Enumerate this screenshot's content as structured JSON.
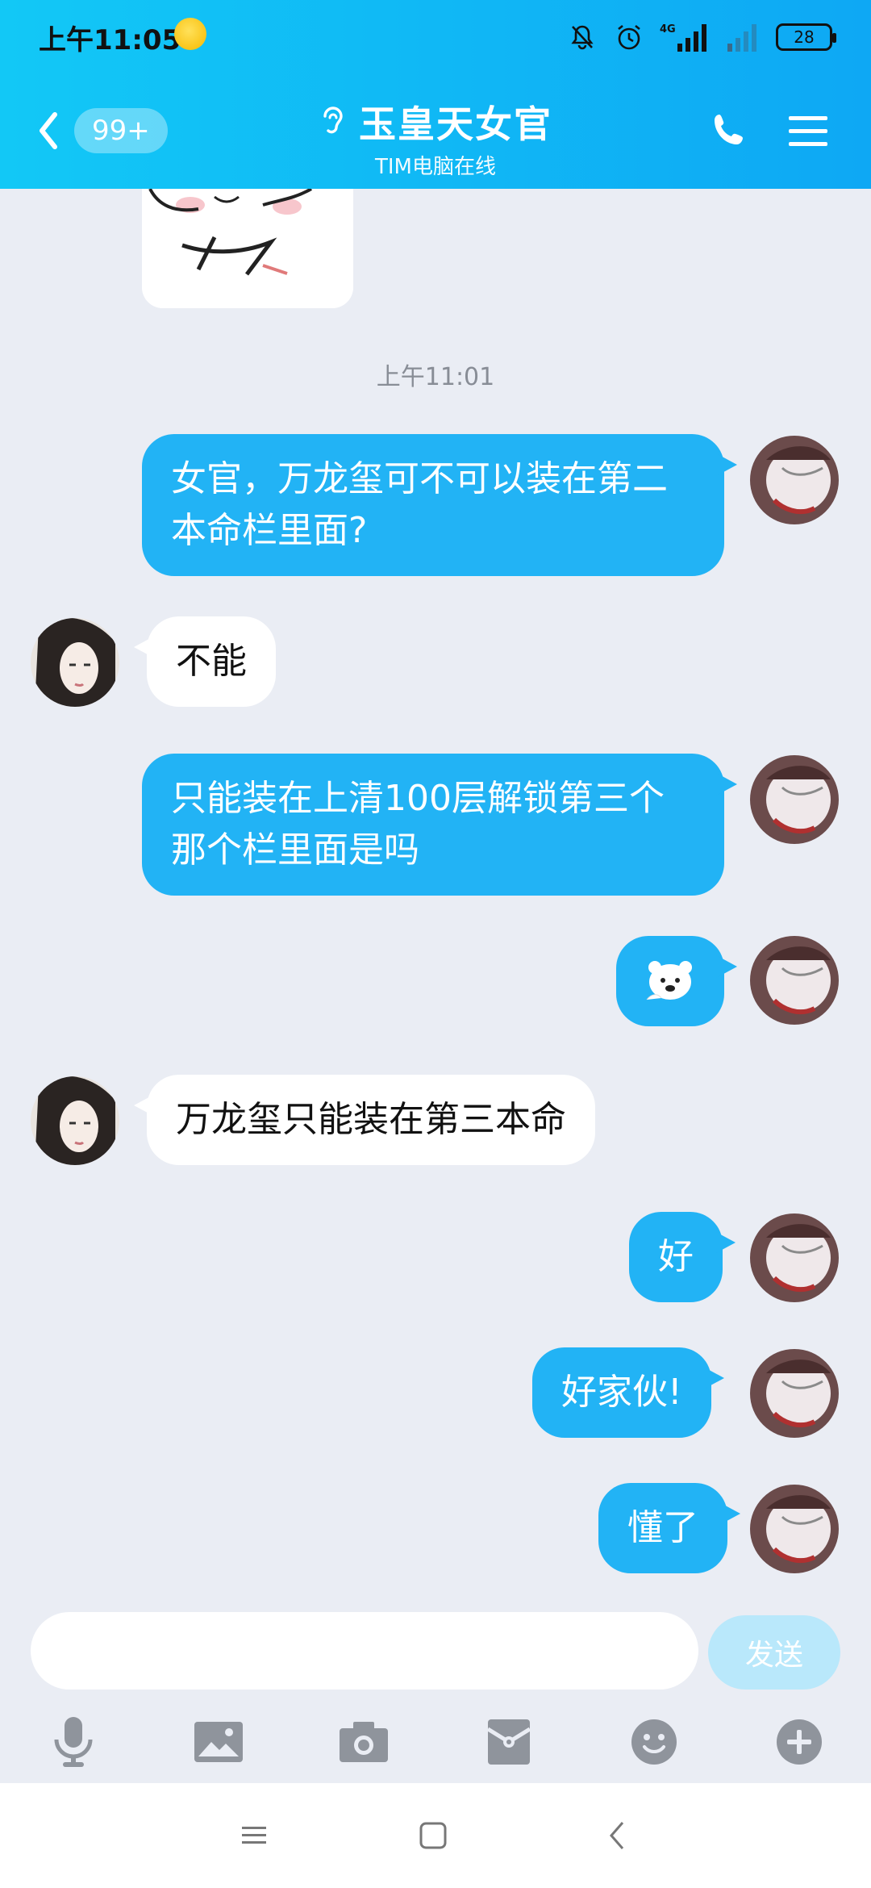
{
  "status_bar": {
    "time": "上午11:05",
    "network": "4G",
    "battery": "28"
  },
  "header": {
    "back_badge": "99+",
    "title": "玉皇天女官",
    "subtitle": "TIM电脑在线"
  },
  "chat": {
    "timestamp": "上午11:01",
    "messages": [
      {
        "from": "me",
        "text": "女官，万龙玺可不可以装在第二\n本命栏里面?"
      },
      {
        "from": "them",
        "text": "不能"
      },
      {
        "from": "me",
        "text": "只能装在上清100层解锁第三个\n那个栏里面是吗"
      },
      {
        "from": "me",
        "type": "emoji",
        "emoji": "polar-bear-sticker"
      },
      {
        "from": "them",
        "text": "万龙玺只能装在第三本命"
      },
      {
        "from": "me",
        "text": "好"
      },
      {
        "from": "me",
        "text": "好家伙!"
      },
      {
        "from": "me",
        "text": "懂了"
      }
    ]
  },
  "input": {
    "value": "",
    "placeholder": "",
    "send_label": "发送"
  },
  "toolbar": {
    "icons": [
      "microphone-icon",
      "image-icon",
      "camera-icon",
      "red-packet-icon",
      "emoji-icon",
      "plus-icon"
    ]
  },
  "colors": {
    "header_gradient_start": "#12c8f6",
    "header_gradient_end": "#0ea8f4",
    "my_bubble": "#22b3f5",
    "their_bubble": "#ffffff",
    "chat_bg": "#eaedf4",
    "send_button": "#b9e8fb"
  }
}
